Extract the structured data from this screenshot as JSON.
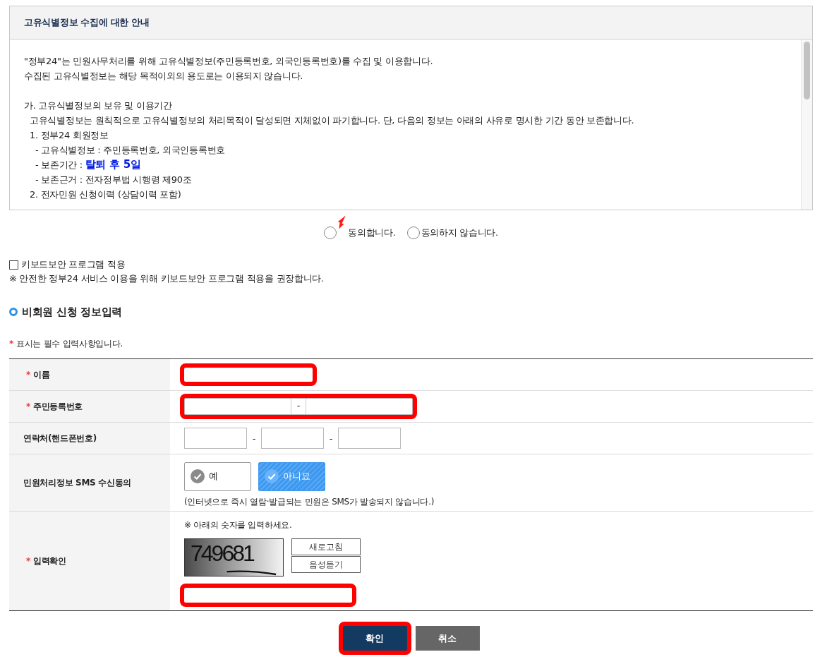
{
  "notice": {
    "title": "고유식별정보 수집에 대한 안내",
    "lines": [
      {
        "kind": "body",
        "text": "\"정부24\"는 민원사무처리를 위해 고유식별정보(주민등록번호, 외국인등록번호)를 수집 및 이용합니다."
      },
      {
        "kind": "body",
        "text": "수집된 고유식별정보는 해당 목적이외의 용도로는 이용되지 않습니다."
      },
      {
        "kind": "gap"
      },
      {
        "kind": "body",
        "text": "가. 고유식별정보의 보유 및 이용기간"
      },
      {
        "kind": "item",
        "text": "고유식별정보는 원칙적으로 고유식별정보의 처리목적이 달성되면 지체없이 파기합니다. 단, 다음의 정보는 아래의 사유로 명시한 기간 동안 보존합니다."
      },
      {
        "kind": "item",
        "text": "1. 정부24 회원정보"
      },
      {
        "kind": "detail",
        "text": "- 고유식별정보 : 주민등록번호, 외국인등록번호"
      },
      {
        "kind": "detail",
        "text": "- 보존기간 : **탈퇴 후 5일**"
      },
      {
        "kind": "detail",
        "text": "- 보존근거 : 전자정부법 시행령 제90조"
      },
      {
        "kind": "item",
        "text": "2. 전자민원 신청이력 (상담이력 포함)"
      }
    ]
  },
  "consent": {
    "options": [
      {
        "label": "동의합니다.",
        "selected": false,
        "pointer": true
      },
      {
        "label": "동의하지 않습니다.",
        "selected": false
      }
    ]
  },
  "keyboard_security": {
    "label": "키보드보안 프로그램 적용",
    "checked": false,
    "note": "※ 안전한 정부24 서비스 이용을 위해 키보드보안 프로그램 적용을 권장합니다."
  },
  "section_title": "비회원 신청 정보입력",
  "required_note": {
    "mark": "*",
    "text": "표시는 필수 입력사항입니다."
  },
  "form_rows": [
    {
      "kind": "text",
      "mark": "*",
      "label": "이름",
      "highlighted": true
    },
    {
      "kind": "split",
      "mark": "*",
      "label": "주민등록번호",
      "separators": [
        "-"
      ],
      "highlighted": true
    },
    {
      "kind": "phone",
      "label": "연락처(핸드폰번호)",
      "separators": [
        "-",
        "-"
      ]
    },
    {
      "kind": "choice",
      "label": "민원처리정보 SMS 수신동의",
      "options": [
        {
          "label": "예",
          "selected": false
        },
        {
          "label": "아니요",
          "selected": true
        }
      ],
      "note": "(인터넷으로 즉시 열람·발급되는 민원은 SMS가 발송되지 않습니다.)"
    },
    {
      "kind": "captcha",
      "mark": "*",
      "label": "입력확인",
      "instruction": "※ 아래의 숫자를 입력하세요.",
      "captcha_text": "749681",
      "buttons": [
        "새로고침",
        "음성듣기"
      ],
      "highlighted": true
    }
  ],
  "buttons": [
    {
      "label": "확인",
      "kind": "primary",
      "highlighted": true
    },
    {
      "label": "취소",
      "kind": "secondary",
      "highlighted": false
    }
  ]
}
